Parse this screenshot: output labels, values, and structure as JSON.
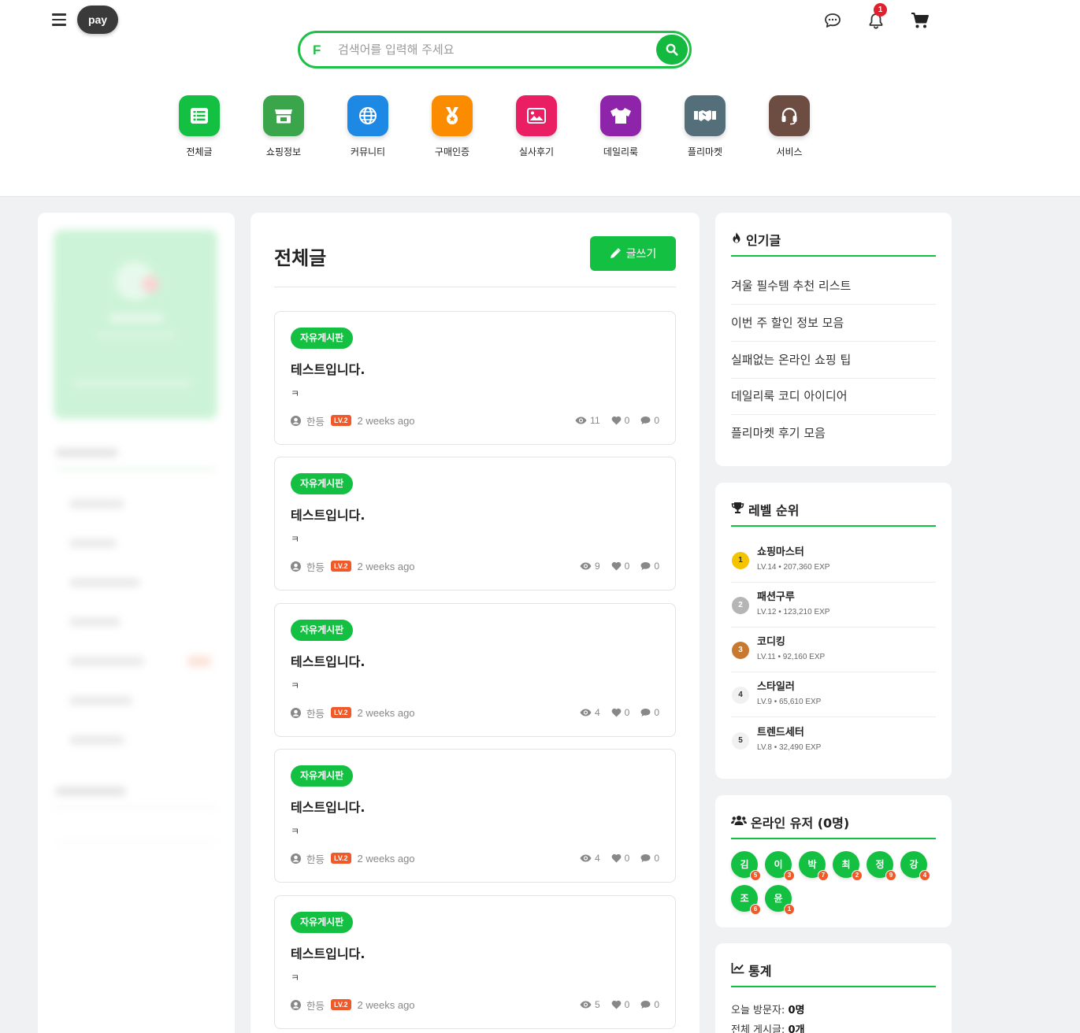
{
  "header": {
    "logo": "pay",
    "search": {
      "prefix": "F",
      "placeholder": "검색어를 입력해 주세요"
    },
    "notification_count": "1"
  },
  "categories": [
    {
      "label": "전체글",
      "color": "#14c042",
      "icon": "list-icon"
    },
    {
      "label": "쇼핑정보",
      "color": "#3aa54a",
      "icon": "store-icon"
    },
    {
      "label": "커뮤니티",
      "color": "#1e88e5",
      "icon": "globe-icon"
    },
    {
      "label": "구매인증",
      "color": "#fb8c00",
      "icon": "medal-icon"
    },
    {
      "label": "실사후기",
      "color": "#e91e63",
      "icon": "image-icon"
    },
    {
      "label": "데일리룩",
      "color": "#8e24aa",
      "icon": "shirt-icon"
    },
    {
      "label": "플리마켓",
      "color": "#546e7a",
      "icon": "handshake-icon"
    },
    {
      "label": "서비스",
      "color": "#6d4c41",
      "icon": "headset-icon"
    }
  ],
  "main": {
    "title": "전체글",
    "write_label": "글쓰기",
    "posts": [
      {
        "tag": "자유게시판",
        "title": "테스트입니다.",
        "body": "ㅋ",
        "author": "한등",
        "level": "LV.2",
        "time": "2 weeks ago",
        "views": "11",
        "likes": "0",
        "comments": "0"
      },
      {
        "tag": "자유게시판",
        "title": "테스트입니다.",
        "body": "ㅋ",
        "author": "한등",
        "level": "LV.2",
        "time": "2 weeks ago",
        "views": "9",
        "likes": "0",
        "comments": "0"
      },
      {
        "tag": "자유게시판",
        "title": "테스트입니다.",
        "body": "ㅋ",
        "author": "한등",
        "level": "LV.2",
        "time": "2 weeks ago",
        "views": "4",
        "likes": "0",
        "comments": "0"
      },
      {
        "tag": "자유게시판",
        "title": "테스트입니다.",
        "body": "ㅋ",
        "author": "한등",
        "level": "LV.2",
        "time": "2 weeks ago",
        "views": "4",
        "likes": "0",
        "comments": "0"
      },
      {
        "tag": "자유게시판",
        "title": "테스트입니다.",
        "body": "ㅋ",
        "author": "한등",
        "level": "LV.2",
        "time": "2 weeks ago",
        "views": "5",
        "likes": "0",
        "comments": "0"
      }
    ]
  },
  "popular": {
    "title": "인기글",
    "items": [
      "겨울 필수템 추천 리스트",
      "이번 주 할인 정보 모음",
      "실패없는 온라인 쇼핑 팁",
      "데일리룩 코디 아이디어",
      "플리마켓 후기 모음"
    ]
  },
  "ranking": {
    "title": "레벨 순위",
    "items": [
      {
        "rank": "1",
        "name": "쇼핑마스터",
        "info": "LV.14 • 207,360 EXP",
        "bg": "#f5c400",
        "fg": "#333"
      },
      {
        "rank": "2",
        "name": "패션구루",
        "info": "LV.12 • 123,210 EXP",
        "bg": "#b5b5b5",
        "fg": "#fff"
      },
      {
        "rank": "3",
        "name": "코디킹",
        "info": "LV.11 • 92,160 EXP",
        "bg": "#c8792f",
        "fg": "#fff"
      },
      {
        "rank": "4",
        "name": "스타일러",
        "info": "LV.9 • 65,610 EXP",
        "bg": "#f1f1f1",
        "fg": "#333"
      },
      {
        "rank": "5",
        "name": "트렌드세터",
        "info": "LV.8 • 32,490 EXP",
        "bg": "#f1f1f1",
        "fg": "#333"
      }
    ]
  },
  "online": {
    "title": "온라인 유저 (0명)",
    "users": [
      {
        "name": "김",
        "level": "5"
      },
      {
        "name": "이",
        "level": "3"
      },
      {
        "name": "박",
        "level": "7"
      },
      {
        "name": "최",
        "level": "2"
      },
      {
        "name": "정",
        "level": "9"
      },
      {
        "name": "강",
        "level": "4"
      },
      {
        "name": "조",
        "level": "6"
      },
      {
        "name": "윤",
        "level": "1"
      }
    ]
  },
  "stats": {
    "title": "통계",
    "visitors_label": "오늘 방문자: ",
    "visitors_value": "0명",
    "posts_label": "전체 게시글: ",
    "posts_value": "0개"
  },
  "colors": {
    "accent": "#14c042",
    "level_badge": "#f05a2a",
    "notification": "#e0202e"
  }
}
